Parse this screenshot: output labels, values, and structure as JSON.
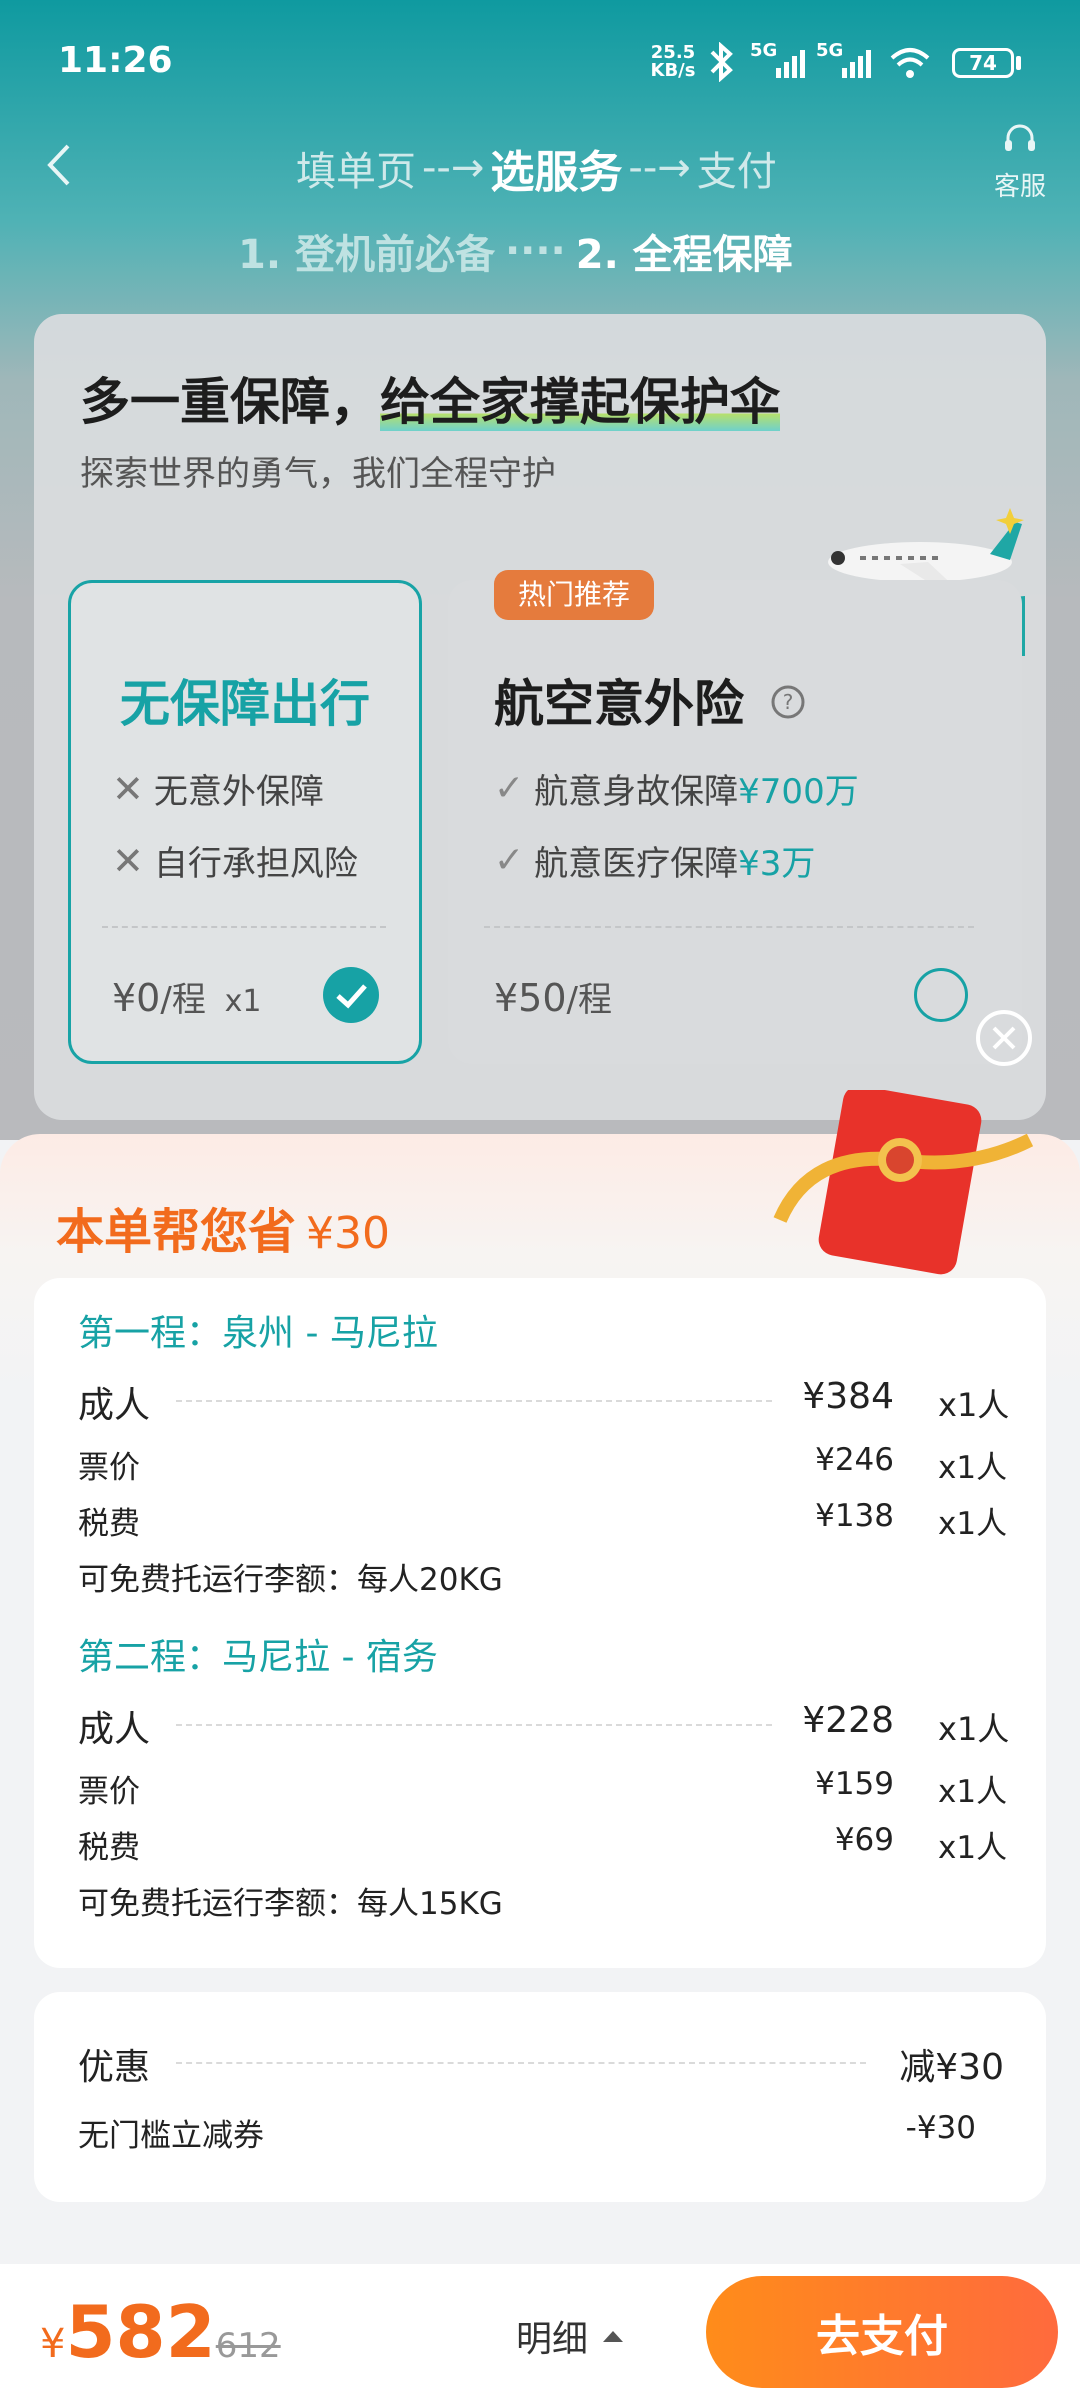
{
  "status_bar": {
    "time": "11:26",
    "net_speed_value": "25.5",
    "net_speed_unit": "KB/s",
    "signal1": "5G",
    "signal2": "5G",
    "battery": "74"
  },
  "header": {
    "steps": [
      "填单页",
      "选服务",
      "支付"
    ],
    "arrow": "--→",
    "service_label": "客服",
    "substeps": [
      "1. 登机前必备",
      "····",
      "2. 全程保障"
    ]
  },
  "insurance": {
    "title_part1": "多一重保障，",
    "title_part2": "给全家撑起保护伞",
    "subtitle": "探索世界的勇气，我们全程守护",
    "option_none": {
      "name": "无保障出行",
      "features": [
        "无意外保障",
        "自行承担风险"
      ],
      "price": "¥0",
      "unit": "/程",
      "qty": "x1",
      "selected": true
    },
    "option_insured": {
      "badge": "热门推荐",
      "name": "航空意外险",
      "features": [
        {
          "label": "航意身故保障",
          "amount": "¥700万"
        },
        {
          "label": "航意医疗保障",
          "amount": "¥3万"
        }
      ],
      "price": "¥50",
      "unit": "/程",
      "selected": false
    }
  },
  "summary": {
    "savings_label": "本单帮您省",
    "savings_amount": "¥30",
    "legs": [
      {
        "title": "第一程：泉州 - 马尼拉",
        "adult_label": "成人",
        "adult_price": "¥384",
        "adult_qty": "x1人",
        "fare_label": "票价",
        "fare": "¥246",
        "fare_qty": "x1人",
        "tax_label": "税费",
        "tax": "¥138",
        "tax_qty": "x1人",
        "baggage": "可免费托运行李额：每人20KG"
      },
      {
        "title": "第二程：马尼拉 - 宿务",
        "adult_label": "成人",
        "adult_price": "¥228",
        "adult_qty": "x1人",
        "fare_label": "票价",
        "fare": "¥159",
        "fare_qty": "x1人",
        "tax_label": "税费",
        "tax": "¥69",
        "tax_qty": "x1人",
        "baggage": "可免费托运行李额：每人15KG"
      }
    ],
    "discount": {
      "label": "优惠",
      "total": "减¥30",
      "coupon_label": "无门槛立减券",
      "coupon_value": "-¥30"
    }
  },
  "bottom": {
    "currency": "¥",
    "price": "582",
    "original_price": "612",
    "detail_label": "明细",
    "pay_label": "去支付"
  },
  "colors": {
    "teal": "#17a2a5",
    "orange": "#f26b1d",
    "pay_gradient_start": "#ff8c1a",
    "pay_gradient_end": "#ff6a3d"
  }
}
